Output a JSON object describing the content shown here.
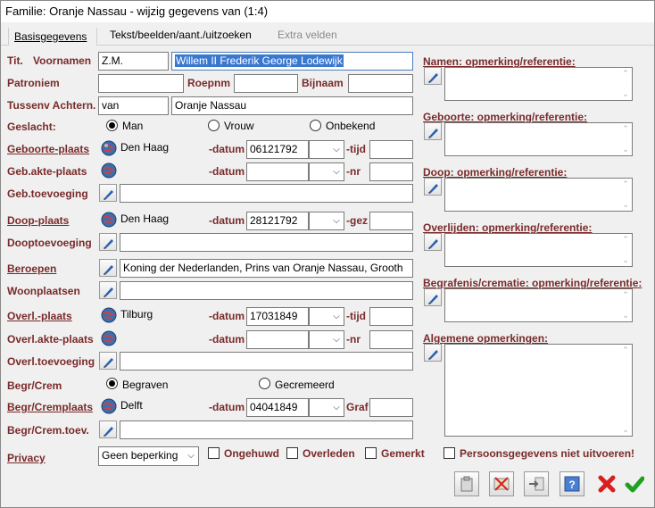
{
  "window": {
    "title": "Familie: Oranje Nassau - wijzig gegevens van (1:4)"
  },
  "tabs": [
    {
      "label": "Basisgegevens",
      "state": "active"
    },
    {
      "label": "Tekst/beelden/aant./uitzoeken",
      "state": "normal"
    },
    {
      "label": "Extra velden",
      "state": "disabled"
    }
  ],
  "form": {
    "tit_label": "Tit.",
    "voornamen_label": "Voornamen",
    "tit_value": "Z.M.",
    "voornamen_value": "Willem II Frederik George Lodewijk",
    "patroniem_label": "Patroniem",
    "patroniem_value": "",
    "roepnm_label": "Roepnm",
    "roepnm_value": "",
    "bijnaam_label": "Bijnaam",
    "bijnaam_value": "",
    "tussenv_label": "Tussenv Achtern.",
    "tussenv_value": "van",
    "achternaam_value": "Oranje Nassau",
    "geslacht_label": "Geslacht:",
    "geslacht_options": [
      "Man",
      "Vrouw",
      "Onbekend"
    ],
    "geslacht_selected": "Man",
    "geboorte_plaats_label": "Geboorte-plaats",
    "geboorte_plaats_value": "Den Haag",
    "geboorte_datum_label": "-datum",
    "geboorte_datum_value": "06121792",
    "geboorte_tijd_label": "-tijd",
    "geboorte_tijd_value": "",
    "gebakte_plaats_label": "Geb.akte-plaats",
    "gebakte_datum_label": "-datum",
    "gebakte_nr_label": "-nr",
    "gebtoevoeging_label": "Geb.toevoeging",
    "gebtoevoeging_value": "",
    "doop_plaats_label": "Doop-plaats",
    "doop_plaats_value": "Den Haag",
    "doop_datum_label": "-datum",
    "doop_datum_value": "28121792",
    "doop_gez_label": "-gez",
    "dooptoevoeging_label": "Dooptoevoeging",
    "dooptoevoeging_value": "",
    "beroepen_label": "Beroepen",
    "beroepen_value": "Koning der Nederlanden, Prins van Oranje Nassau, Grooth",
    "woonplaatsen_label": "Woonplaatsen",
    "woonplaatsen_value": "",
    "overl_plaats_label": "Overl.-plaats",
    "overl_plaats_value": "Tilburg",
    "overl_datum_label": "-datum",
    "overl_datum_value": "17031849",
    "overl_tijd_label": "-tijd",
    "overlakte_plaats_label": "Overl.akte-plaats",
    "overlakte_datum_label": "-datum",
    "overlakte_nr_label": "-nr",
    "overltoevoeging_label": "Overl.toevoeging",
    "overltoevoeging_value": "",
    "begrcrem_label": "Begr/Crem",
    "begrcrem_options": [
      "Begraven",
      "Gecremeerd"
    ],
    "begrcrem_selected": "Begraven",
    "begrcremplaats_label": "Begr/Cremplaats",
    "begrcremplaats_value": "Delft",
    "begr_datum_label": "-datum",
    "begr_datum_value": "04041849",
    "graf_label": "Graf",
    "begrcremtoev_label": "Begr/Crem.toev.",
    "begrcremtoev_value": "",
    "privacy_label": "Privacy",
    "privacy_value": "Geen beperking",
    "checkboxes": [
      "Ongehuwd",
      "Overleden",
      "Gemerkt",
      "Persoonsgegevens niet uitvoeren!"
    ]
  },
  "notes": [
    {
      "label": "Namen: opmerking/referentie:",
      "value": ""
    },
    {
      "label": "Geboorte: opmerking/referentie:",
      "value": ""
    },
    {
      "label": "Doop: opmerking/referentie:",
      "value": ""
    },
    {
      "label": "Overlijden: opmerking/referentie:",
      "value": ""
    },
    {
      "label": "Begrafenis/crematie: opmerking/referentie:",
      "value": ""
    },
    {
      "label": "Algemene opmerkingen:",
      "value": ""
    }
  ],
  "toolbar": [
    "clipboard-icon",
    "clear-icon",
    "import-icon",
    "help-icon",
    "cancel-icon",
    "ok-icon"
  ],
  "colors": {
    "label": "#7a2a2a",
    "selection": "#3a78d0",
    "cancel": "#d82020",
    "ok": "#20a020"
  }
}
